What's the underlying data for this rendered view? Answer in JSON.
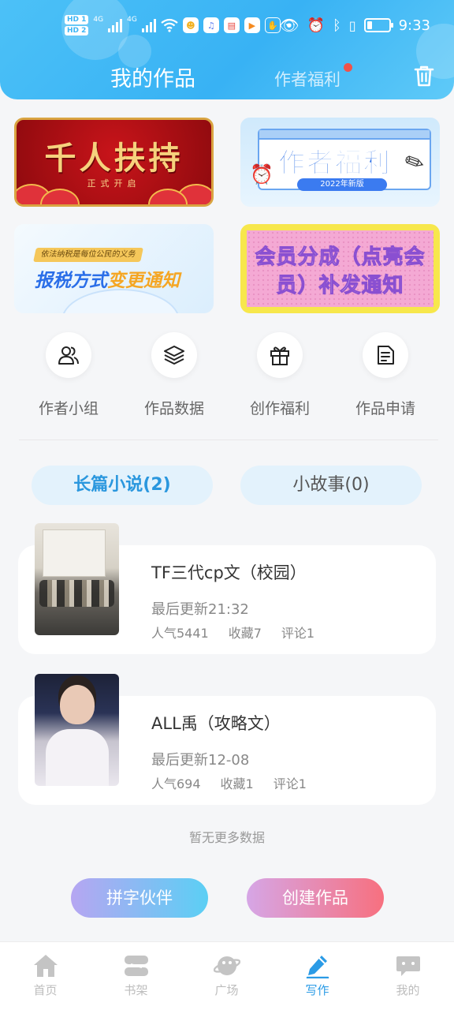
{
  "status_bar": {
    "hd1": "HD 1",
    "hd2": "HD 2",
    "net1": "4G",
    "net2": "4G",
    "more": "···",
    "time": "9:33"
  },
  "header": {
    "tab_works": "我的作品",
    "tab_welfare": "作者福利",
    "accent_color": "#3db6f5"
  },
  "banners": [
    {
      "title": "千人扶持",
      "subtitle": "正式开启"
    },
    {
      "title": "作者福利",
      "badge": "2022年新版"
    },
    {
      "tag": "依法纳税是每位公民的义务",
      "title_a": "报税方式",
      "title_b": "变更通知"
    },
    {
      "line1": "会员分成（点亮会",
      "line2": "员）补发通知"
    }
  ],
  "quick_menu": [
    {
      "label": "作者小组",
      "icon": "group-icon"
    },
    {
      "label": "作品数据",
      "icon": "layers-icon"
    },
    {
      "label": "创作福利",
      "icon": "gift-icon"
    },
    {
      "label": "作品申请",
      "icon": "document-icon"
    }
  ],
  "segments": {
    "long": "长篇小说(2)",
    "short": "小故事(0)"
  },
  "works": [
    {
      "title": "TF三代cp文（校园）",
      "updated": "最后更新21:32",
      "popularity": "人气5441",
      "favorites": "收藏7",
      "comments": "评论1"
    },
    {
      "title": "ALL禹（攻略文）",
      "updated": "最后更新12-08",
      "popularity": "人气694",
      "favorites": "收藏1",
      "comments": "评论1"
    }
  ],
  "no_more": "暂无更多数据",
  "buttons": {
    "partner": "拼字伙伴",
    "create": "创建作品"
  },
  "nav": [
    {
      "label": "首页",
      "icon": "home-icon"
    },
    {
      "label": "书架",
      "icon": "bookshelf-icon"
    },
    {
      "label": "广场",
      "icon": "planet-icon"
    },
    {
      "label": "写作",
      "icon": "pen-icon"
    },
    {
      "label": "我的",
      "icon": "chat-bubble-icon"
    }
  ]
}
